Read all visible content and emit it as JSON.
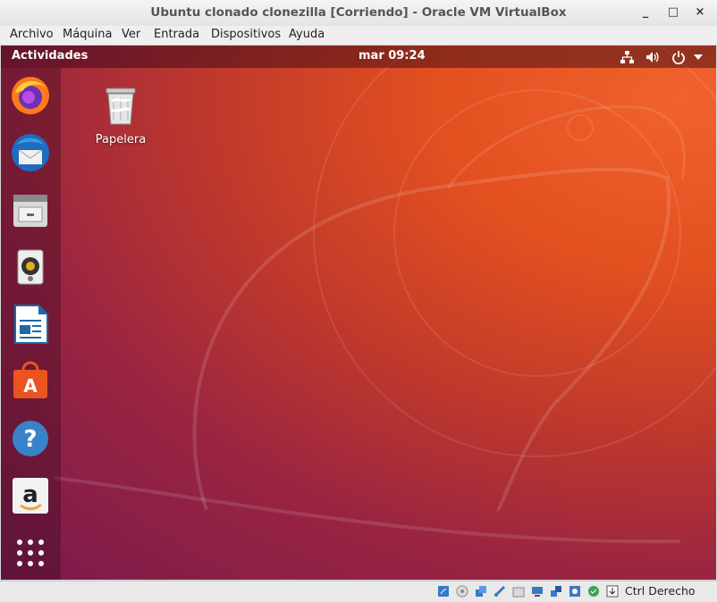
{
  "window": {
    "title": "Ubuntu clonado clonezilla [Corriendo] - Oracle VM VirtualBox",
    "minimize": "_",
    "maximize": "□",
    "close": "×"
  },
  "menu": [
    "Archivo",
    "Máquina",
    "Ver",
    "Entrada",
    "Dispositivos",
    "Ayuda"
  ],
  "topbar": {
    "activities": "Actividades",
    "clock": "mar 09:24",
    "tray_icons": [
      "network-icon",
      "volume-icon",
      "power-icon",
      "chevron-down-icon"
    ]
  },
  "dock": {
    "apps": [
      "firefox-icon",
      "thunderbird-icon",
      "files-icon",
      "rhythmbox-icon",
      "libreoffice-writer-icon",
      "software-center-icon",
      "help-icon",
      "amazon-icon"
    ],
    "show_apps": "show-applications-icon"
  },
  "desktop": {
    "trash_label": "Papelera"
  },
  "statusbar": {
    "host_key": "Ctrl Derecho"
  },
  "colors": {
    "wallpaper_orange": "#e35020",
    "wallpaper_purple": "#7a1a4d"
  }
}
